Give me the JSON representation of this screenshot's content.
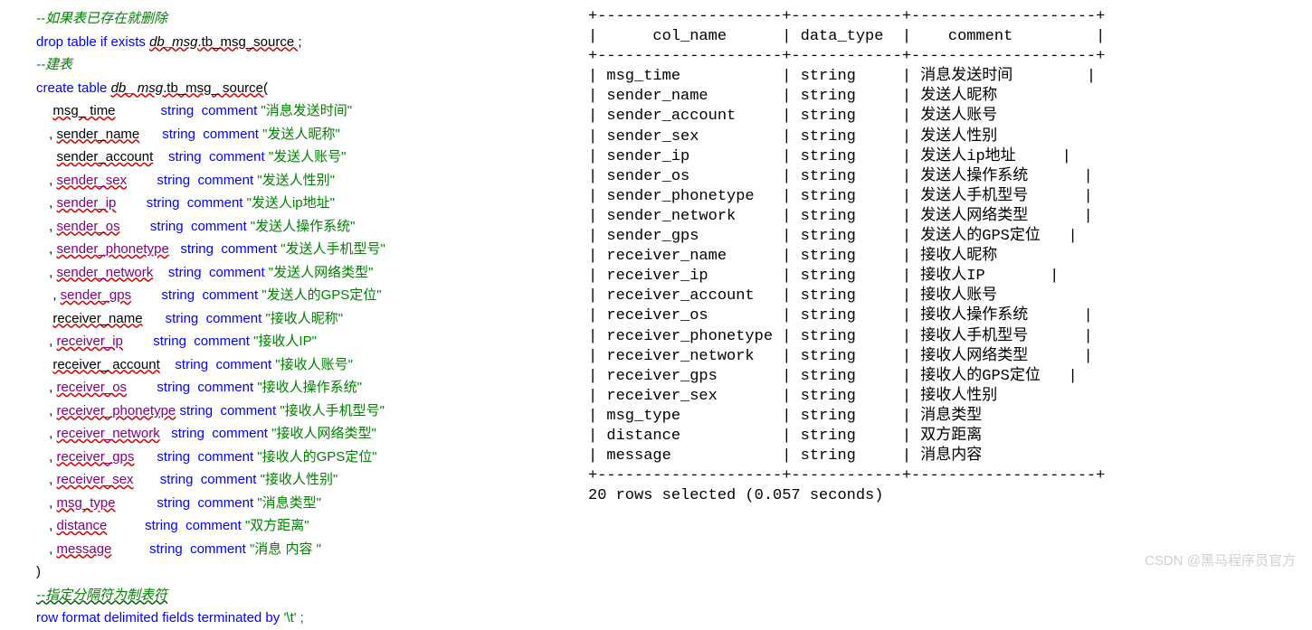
{
  "sql": {
    "c1": "--如果表已存在就删除",
    "drop_kw": "drop table if exists ",
    "drop_db": "db_msg",
    "drop_tbl": ".tb_msg_source ;",
    "c2": "--建表",
    "create_kw": "create table ",
    "create_db": "db_ msg",
    "create_tbl1": ".tb_msg_ source(",
    "cols": [
      {
        "lead": "  ",
        "name": "msg_ time",
        "cls": "col-b",
        "sep": "            ",
        "type": "string  ",
        "comm": "comment ",
        "str": "\"消息发送时间\""
      },
      {
        "lead": " , ",
        "name": "sender_name",
        "cls": "col-b",
        "sep": "      ",
        "type": "string  ",
        "comm": "comment ",
        "str": "\"发送人昵称\""
      },
      {
        "lead": "   ",
        "name": "sender_account",
        "cls": "col-b",
        "sep": "    ",
        "type": "string  ",
        "comm": "comment ",
        "str": "\"发送人账号\""
      },
      {
        "lead": " , ",
        "name": "sender_sex",
        "cls": "col",
        "sep": "        ",
        "type": "string  ",
        "comm": "comment ",
        "str": "\"发送人性别\""
      },
      {
        "lead": " , ",
        "name": "sender_ip",
        "cls": "col",
        "sep": "        ",
        "type": "string  ",
        "comm": "comment ",
        "str": "\"发送人ip地址\""
      },
      {
        "lead": " , ",
        "name": "sender_os",
        "cls": "col",
        "sep": "        ",
        "type": "string  ",
        "comm": "comment ",
        "str": "\"发送人操作系统\""
      },
      {
        "lead": " , ",
        "name": "sender_phonetype",
        "cls": "col",
        "sep": "   ",
        "type": "string  ",
        "comm": "comment ",
        "str": "\"发送人手机型号\""
      },
      {
        "lead": " , ",
        "name": "sender_network",
        "cls": "col",
        "sep": "    ",
        "type": "string  ",
        "comm": "comment ",
        "str": "\"发送人网络类型\""
      },
      {
        "lead": "  , ",
        "name": "sender_gps",
        "cls": "col",
        "sep": "        ",
        "type": "string  ",
        "comm": "comment ",
        "str": "\"发送人的GPS定位\""
      },
      {
        "lead": "  ",
        "name": "receiver_name",
        "cls": "col-b",
        "sep": "      ",
        "type": "string  ",
        "comm": "comment ",
        "str": "\"接收人昵称\""
      },
      {
        "lead": " , ",
        "name": "receiver_ip",
        "cls": "col",
        "sep": "        ",
        "type": "string  ",
        "comm": "comment ",
        "str": "\"接收人IP\""
      },
      {
        "lead": "  ",
        "name": "receiver_ account",
        "cls": "col-b",
        "sep": "    ",
        "type": "string  ",
        "comm": "comment ",
        "str": "\"接收人账号\""
      },
      {
        "lead": " , ",
        "name": "receiver_os",
        "cls": "col",
        "sep": "        ",
        "type": "string  ",
        "comm": "comment ",
        "str": "\"接收人操作系统\""
      },
      {
        "lead": " , ",
        "name": "receiver_phonetype",
        "cls": "col",
        "sep": " ",
        "type": "string  ",
        "comm": "comment ",
        "str": "\"接收人手机型号\""
      },
      {
        "lead": " , ",
        "name": "receiver_network",
        "cls": "col",
        "sep": "   ",
        "type": "string  ",
        "comm": "comment ",
        "str": "\"接收人网络类型\""
      },
      {
        "lead": " , ",
        "name": "receiver_gps",
        "cls": "col",
        "sep": "      ",
        "type": "string  ",
        "comm": "comment ",
        "str": "\"接收人的GPS定位\""
      },
      {
        "lead": " , ",
        "name": "receiver_sex",
        "cls": "col",
        "sep": "       ",
        "type": "string  ",
        "comm": "comment ",
        "str": "\"接收人性别\""
      },
      {
        "lead": " , ",
        "name": "msg_type",
        "cls": "col",
        "sep": "           ",
        "type": "string  ",
        "comm": "comment ",
        "str": "\"消息类型\""
      },
      {
        "lead": " , ",
        "name": "distance",
        "cls": "col",
        "sep": "          ",
        "type": "string  ",
        "comm": "comment ",
        "str": "\"双方距离\""
      },
      {
        "lead": " , ",
        "name": "message",
        "cls": "col",
        "sep": "          ",
        "type": "string  ",
        "comm": "comment ",
        "str": "\"消息 内容 \""
      }
    ],
    "close_paren": ")",
    "c3": "--指定分隔符为制表符",
    "rowfmt_kw": "row format delimited fields terminated by ",
    "rowfmt_str": "'\\t' ;"
  },
  "table": {
    "border_top": "+--------------------+------------+--------------------+",
    "header": "|      col_name      | data_type  |    comment         |",
    "border_mid": "+--------------------+------------+--------------------+",
    "rows": [
      {
        "c1": "msg_time",
        "c2": "string",
        "c3": "消息发送时间        |"
      },
      {
        "c1": "sender_name",
        "c2": "string",
        "c3": "发送人昵称"
      },
      {
        "c1": "sender_account",
        "c2": "string",
        "c3": "发送人账号"
      },
      {
        "c1": "sender_sex",
        "c2": "string",
        "c3": "发送人性别"
      },
      {
        "c1": "sender_ip",
        "c2": "string",
        "c3": "发送人ip地址     |"
      },
      {
        "c1": "sender_os",
        "c2": "string",
        "c3": "发送人操作系统      |"
      },
      {
        "c1": "sender_phonetype",
        "c2": "string",
        "c3": "发送人手机型号      |"
      },
      {
        "c1": "sender_network",
        "c2": "string",
        "c3": "发送人网络类型      |"
      },
      {
        "c1": "sender_gps",
        "c2": "string",
        "c3": "发送人的GPS定位   |"
      },
      {
        "c1": "receiver_name",
        "c2": "string",
        "c3": "接收人昵称"
      },
      {
        "c1": "receiver_ip",
        "c2": "string",
        "c3": "接收人IP       |"
      },
      {
        "c1": "receiver_account",
        "c2": "string",
        "c3": "接收人账号"
      },
      {
        "c1": "receiver_os",
        "c2": "string",
        "c3": "接收人操作系统      |"
      },
      {
        "c1": "receiver_phonetype",
        "c2": "string",
        "c3": "接收人手机型号      |"
      },
      {
        "c1": "receiver_network",
        "c2": "string",
        "c3": "接收人网络类型      |"
      },
      {
        "c1": "receiver_gps",
        "c2": "string",
        "c3": "接收人的GPS定位   |"
      },
      {
        "c1": "receiver_sex",
        "c2": "string",
        "c3": "接收人性别"
      },
      {
        "c1": "msg_type",
        "c2": "string",
        "c3": "消息类型"
      },
      {
        "c1": "distance",
        "c2": "string",
        "c3": "双方距离"
      },
      {
        "c1": "message",
        "c2": "string",
        "c3": "消息内容"
      }
    ],
    "border_bot": "+--------------------+------------+--------------------+",
    "footer": "20 rows selected (0.057 seconds)"
  },
  "watermark": "CSDN @黑马程序员官方"
}
